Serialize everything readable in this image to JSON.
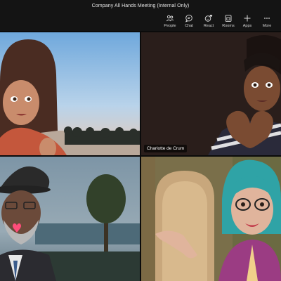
{
  "window": {
    "title": "Company All Hands Meeting (Internal Only)"
  },
  "toolbar": {
    "items": [
      {
        "label": "People",
        "icon": "people-icon"
      },
      {
        "label": "Chat",
        "icon": "chat-icon"
      },
      {
        "label": "React",
        "icon": "react-icon"
      },
      {
        "label": "Rooms",
        "icon": "rooms-icon"
      },
      {
        "label": "Apps",
        "icon": "apps-icon"
      },
      {
        "label": "More",
        "icon": "more-icon"
      }
    ]
  },
  "participants": [
    {
      "name": ""
    },
    {
      "name": "Charlotte de Crum"
    },
    {
      "name": ""
    },
    {
      "name": ""
    }
  ],
  "colors": {
    "background": "#0b0b0b",
    "toolbar": "#141414"
  }
}
